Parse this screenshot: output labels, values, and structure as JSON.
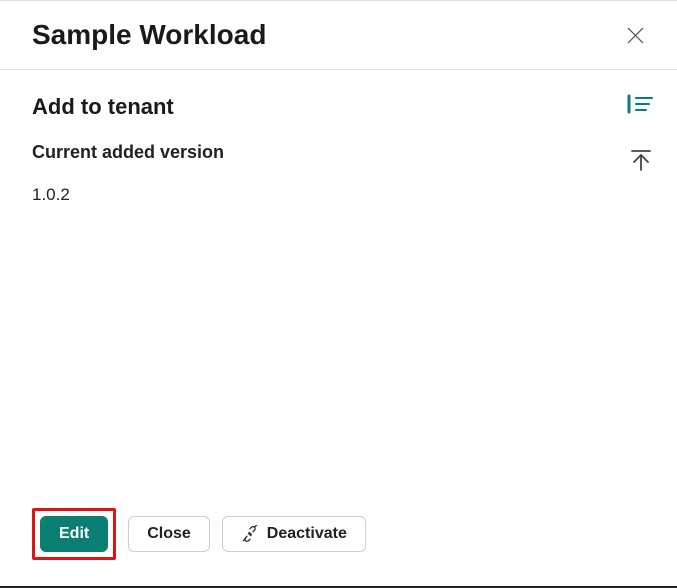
{
  "header": {
    "title": "Sample Workload"
  },
  "main": {
    "section_title": "Add to tenant",
    "subheading": "Current added version",
    "version": "1.0.2"
  },
  "footer": {
    "edit_label": "Edit",
    "close_label": "Close",
    "deactivate_label": "Deactivate"
  },
  "colors": {
    "accent": "#0a7e72",
    "highlight": "#d91515"
  }
}
